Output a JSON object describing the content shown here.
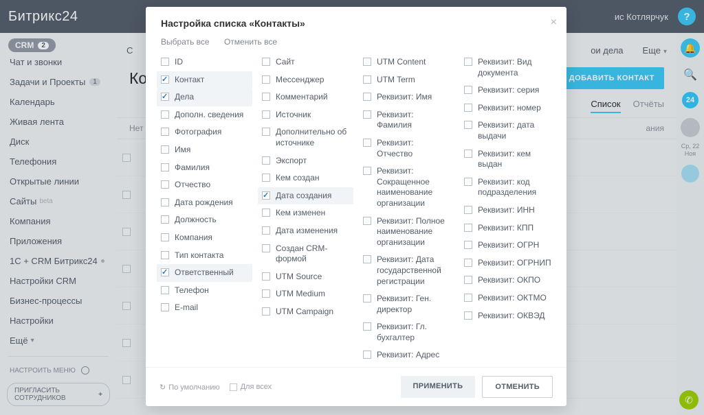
{
  "topbar": {
    "logo": "Битрикс24",
    "user": "ис Котлярчук"
  },
  "leftnav": {
    "crm_label": "CRM",
    "crm_count": "2",
    "items": [
      {
        "label": "Чат и звонки"
      },
      {
        "label": "Задачи и Проекты",
        "badge": "1"
      },
      {
        "label": "Календарь"
      },
      {
        "label": "Живая лента"
      },
      {
        "label": "Диск"
      },
      {
        "label": "Телефония"
      },
      {
        "label": "Открытые линии"
      },
      {
        "label": "Сайты",
        "beta": "beta"
      },
      {
        "label": "Компания"
      },
      {
        "label": "Приложения"
      },
      {
        "label": "1С + CRM Битрикс24",
        "dot": true
      },
      {
        "label": "Настройки CRM"
      },
      {
        "label": "Бизнес-процессы"
      },
      {
        "label": "Настройки"
      }
    ],
    "more": "Ещё",
    "configure": "НАСТРОИТЬ МЕНЮ",
    "invite": "ПРИГЛАСИТЬ СОТРУДНИКОВ"
  },
  "main": {
    "tab_left": "С",
    "tab_mid": "ои дела",
    "tab_more": "Еще",
    "title": "Ко",
    "title_rest": "ания",
    "add_btn": "ДОБАВИТЬ КОНТАКТ",
    "view_list": "Список",
    "view_reports": "Отчёты",
    "col1": "Нет"
  },
  "rail": {
    "date_line": "Ср, 22 Ноя"
  },
  "modal": {
    "title": "Настройка списка «Контакты»",
    "select_all": "Выбрать все",
    "deselect_all": "Отменить все",
    "apply": "ПРИМЕНИТЬ",
    "cancel": "ОТМЕНИТЬ",
    "reset": "По умолчанию",
    "for_all": "Для всех",
    "columns": [
      [
        {
          "label": "ID",
          "checked": false
        },
        {
          "label": "Контакт",
          "checked": true
        },
        {
          "label": "Дела",
          "checked": true
        },
        {
          "label": "Дополн. сведения",
          "checked": false
        },
        {
          "label": "Фотография",
          "checked": false
        },
        {
          "label": "Имя",
          "checked": false
        },
        {
          "label": "Фамилия",
          "checked": false
        },
        {
          "label": "Отчество",
          "checked": false
        },
        {
          "label": "Дата рождения",
          "checked": false
        },
        {
          "label": "Должность",
          "checked": false
        },
        {
          "label": "Компания",
          "checked": false
        },
        {
          "label": "Тип контакта",
          "checked": false
        },
        {
          "label": "Ответственный",
          "checked": true
        },
        {
          "label": "Телефон",
          "checked": false
        },
        {
          "label": "E-mail",
          "checked": false
        }
      ],
      [
        {
          "label": "Сайт",
          "checked": false
        },
        {
          "label": "Мессенджер",
          "checked": false
        },
        {
          "label": "Комментарий",
          "checked": false
        },
        {
          "label": "Источник",
          "checked": false
        },
        {
          "label": "Дополнительно об источнике",
          "checked": false
        },
        {
          "label": "Экспорт",
          "checked": false
        },
        {
          "label": "Кем создан",
          "checked": false
        },
        {
          "label": "Дата создания",
          "checked": true
        },
        {
          "label": "Кем изменен",
          "checked": false
        },
        {
          "label": "Дата изменения",
          "checked": false
        },
        {
          "label": "Создан CRM-формой",
          "checked": false
        },
        {
          "label": "UTM Source",
          "checked": false
        },
        {
          "label": "UTM Medium",
          "checked": false
        },
        {
          "label": "UTM Campaign",
          "checked": false
        }
      ],
      [
        {
          "label": "UTM Content",
          "checked": false
        },
        {
          "label": "UTM Term",
          "checked": false
        },
        {
          "label": "Реквизит: Имя",
          "checked": false
        },
        {
          "label": "Реквизит: Фамилия",
          "checked": false
        },
        {
          "label": "Реквизит: Отчество",
          "checked": false
        },
        {
          "label": "Реквизит: Сокращенное наименование организации",
          "checked": false
        },
        {
          "label": "Реквизит: Полное наименование организации",
          "checked": false
        },
        {
          "label": "Реквизит: Дата государственной регистрации",
          "checked": false
        },
        {
          "label": "Реквизит: Ген. директор",
          "checked": false
        },
        {
          "label": "Реквизит: Гл. бухгалтер",
          "checked": false
        },
        {
          "label": "Реквизит: Адрес",
          "checked": false
        }
      ],
      [
        {
          "label": "Реквизит: Вид документа",
          "checked": false
        },
        {
          "label": "Реквизит: серия",
          "checked": false
        },
        {
          "label": "Реквизит: номер",
          "checked": false
        },
        {
          "label": "Реквизит: дата выдачи",
          "checked": false
        },
        {
          "label": "Реквизит: кем выдан",
          "checked": false
        },
        {
          "label": "Реквизит: код подразделения",
          "checked": false
        },
        {
          "label": "Реквизит: ИНН",
          "checked": false
        },
        {
          "label": "Реквизит: КПП",
          "checked": false
        },
        {
          "label": "Реквизит: ОГРН",
          "checked": false
        },
        {
          "label": "Реквизит: ОГРНИП",
          "checked": false
        },
        {
          "label": "Реквизит: ОКПО",
          "checked": false
        },
        {
          "label": "Реквизит: ОКТМО",
          "checked": false
        },
        {
          "label": "Реквизит: ОКВЭД",
          "checked": false
        }
      ]
    ]
  }
}
